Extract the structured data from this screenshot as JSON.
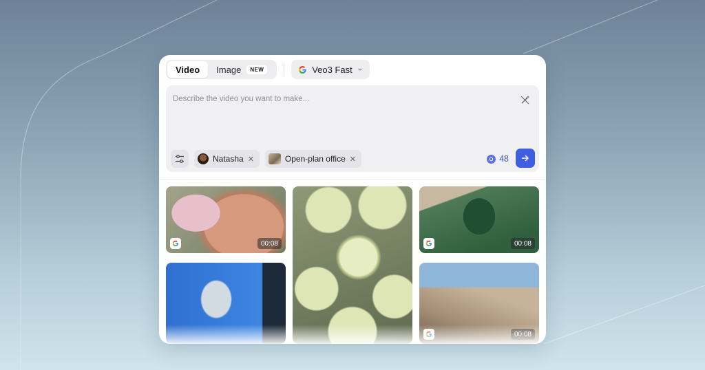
{
  "tabs": [
    {
      "label": "Video",
      "active": true
    },
    {
      "label": "Image",
      "active": false,
      "badge": "NEW"
    }
  ],
  "model": {
    "label": "Veo3 Fast",
    "icon": "google-icon"
  },
  "prompt": {
    "placeholder": "Describe the video you want to make...",
    "value": ""
  },
  "chips": [
    {
      "label": "Natasha",
      "icon": "avatar"
    },
    {
      "label": "Open-plan office",
      "icon": "thumbnail"
    }
  ],
  "credits": {
    "value": "48"
  },
  "tiles": [
    {
      "duration": "00:08",
      "provider": "google-icon"
    },
    {
      "duration": "",
      "provider": ""
    },
    {
      "duration": "00:08",
      "provider": "google-icon"
    },
    {
      "duration": "",
      "provider": ""
    },
    {
      "duration": "00:08",
      "provider": "google-icon"
    }
  ],
  "colors": {
    "accent": "#3f5fe0",
    "credit_text": "#3c5ccf"
  }
}
